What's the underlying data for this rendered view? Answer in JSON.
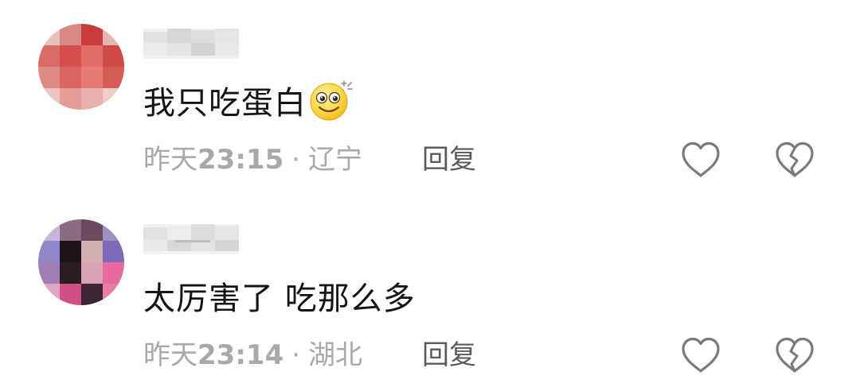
{
  "comments": [
    {
      "text": "我只吃蛋白",
      "emoji": "dizzy-smile-emoji",
      "date": "昨天",
      "time": "23:15",
      "separator": "·",
      "location": "辽宁",
      "reply_label": "回复",
      "like_icon": "heart-outline-icon",
      "dislike_icon": "broken-heart-icon"
    },
    {
      "text": "太厉害了 吃那么多",
      "date": "昨天",
      "time": "23:14",
      "separator": "·",
      "location": "湖北",
      "reply_label": "回复",
      "like_icon": "heart-outline-icon",
      "dislike_icon": "broken-heart-icon"
    }
  ],
  "colors": {
    "meta_text": "#a9a9a9",
    "reply_text": "#5a5a5a",
    "icon_stroke": "#7a7a7a",
    "comment_text": "#141414"
  }
}
